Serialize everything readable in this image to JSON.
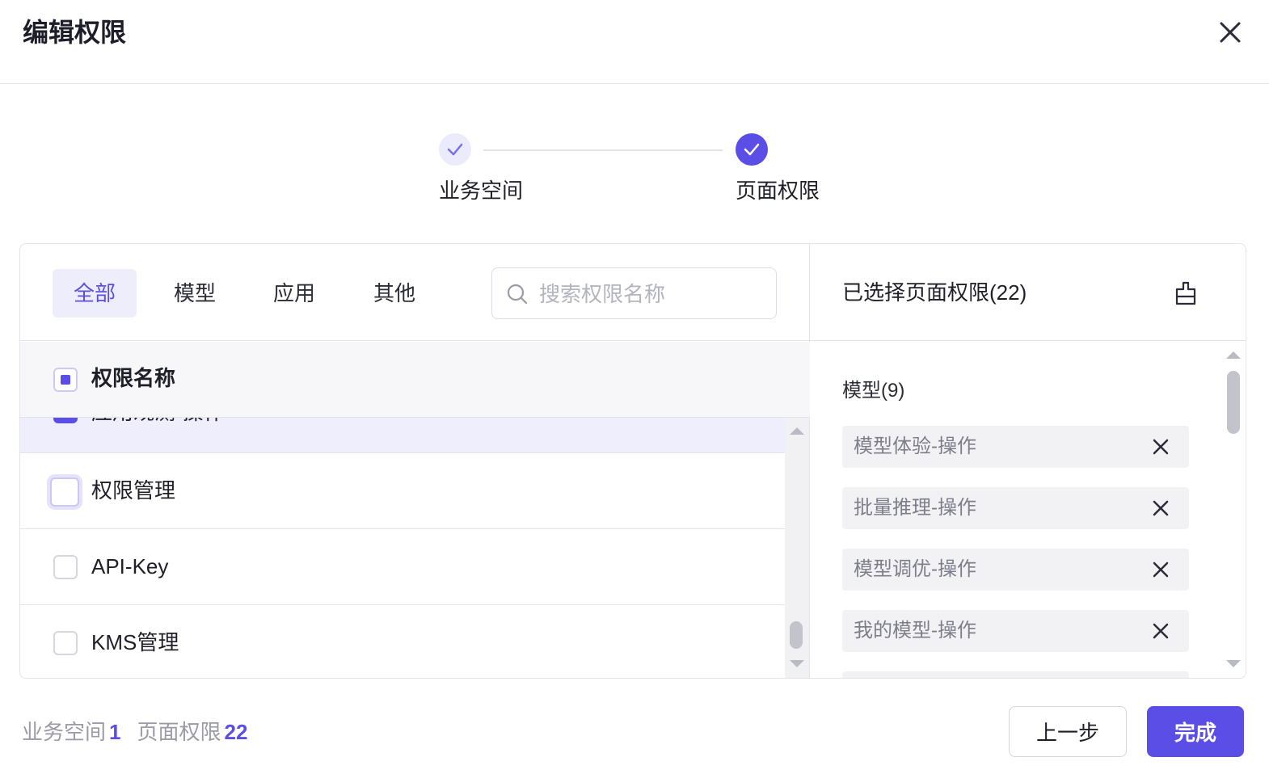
{
  "dialog": {
    "title": "编辑权限",
    "close_icon": "close-icon"
  },
  "steps": [
    {
      "label": "业务空间",
      "status": "done",
      "icon": "check-icon"
    },
    {
      "label": "页面权限",
      "status": "active",
      "icon": "check-icon"
    }
  ],
  "tabs": [
    {
      "label": "全部",
      "selected": true
    },
    {
      "label": "模型",
      "selected": false
    },
    {
      "label": "应用",
      "selected": false
    },
    {
      "label": "其他",
      "selected": false
    }
  ],
  "search": {
    "placeholder": "搜索权限名称",
    "value": "",
    "icon": "search-icon"
  },
  "table": {
    "header_label": "权限名称",
    "header_checkbox": "indeterminate",
    "rows": [
      {
        "label": "应用观测-操作",
        "checked": true
      },
      {
        "label": "权限管理",
        "checked": false
      },
      {
        "label": "API-Key",
        "checked": false
      },
      {
        "label": "KMS管理",
        "checked": false
      }
    ]
  },
  "selected_panel": {
    "title": "已选择页面权限(22)",
    "clear_icon": "clear-icon",
    "groups": [
      {
        "title": "模型(9)",
        "items": [
          "模型体验-操作",
          "批量推理-操作",
          "模型调优-操作",
          "我的模型-操作"
        ]
      }
    ]
  },
  "footer": {
    "workspace_label": "业务空间",
    "workspace_count": "1",
    "page_perm_label": "页面权限",
    "page_perm_count": "22",
    "prev_label": "上一步",
    "done_label": "完成"
  },
  "colors": {
    "accent": "#5b4ee6",
    "accent_light": "#eeedfc",
    "border": "#e3e4ea",
    "chip_bg": "#f2f2f5"
  }
}
